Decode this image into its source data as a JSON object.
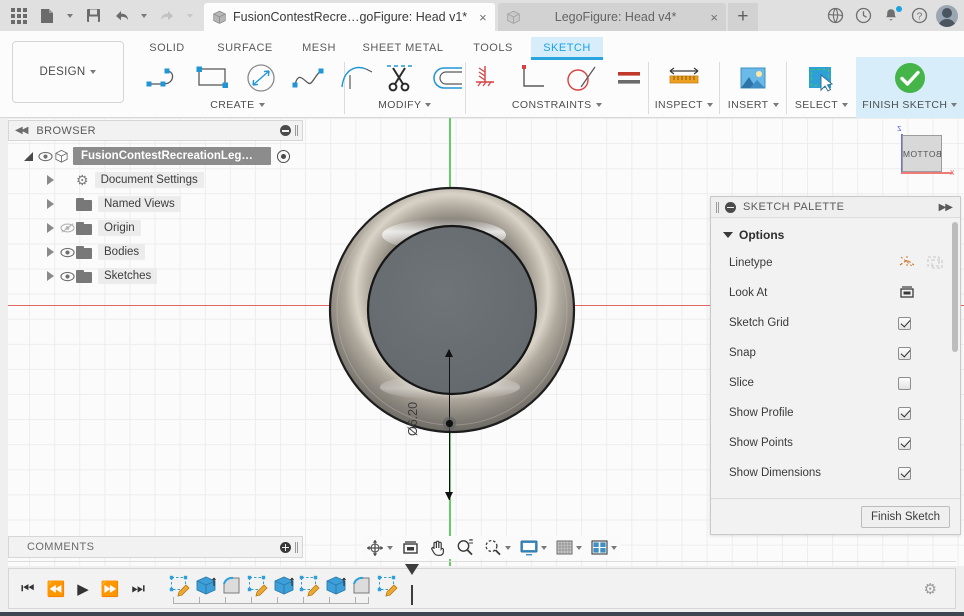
{
  "titlebar": {
    "app_menu_icon": "grid-apps-icon",
    "file_icon": "file-icon",
    "save_icon": "save-icon",
    "undo_icon": "undo-icon",
    "redo_icon": "redo-icon",
    "tabs": [
      {
        "label": "FusionContestRecre…goFigure: Head v1*",
        "icon": "cube-icon",
        "active": true,
        "close": "×"
      },
      {
        "label": "LegoFigure: Head v4*",
        "icon": "cube-icon",
        "active": false,
        "close": "×"
      }
    ],
    "new_tab_label": "+",
    "right_icons": [
      "globe-icon",
      "clock-icon",
      "bell-icon",
      "help-icon",
      "avatar"
    ]
  },
  "ribbon": {
    "design_label": "DESIGN",
    "workspace_tabs": [
      {
        "label": "SOLID",
        "active": false
      },
      {
        "label": "SURFACE",
        "active": false
      },
      {
        "label": "MESH",
        "active": false
      },
      {
        "label": "SHEET METAL",
        "active": false
      },
      {
        "label": "TOOLS",
        "active": false
      },
      {
        "label": "SKETCH",
        "active": true
      }
    ],
    "panels": [
      {
        "label": "CREATE",
        "dropdown": true,
        "tools": [
          "line-icon",
          "rectangle-icon",
          "circle-icon",
          "spline-icon",
          "arc-icon"
        ]
      },
      {
        "label": "MODIFY",
        "dropdown": true,
        "tools": [
          "trim-scissors-icon",
          "offset-icon"
        ]
      },
      {
        "label": "CONSTRAINTS",
        "dropdown": true,
        "tools": [
          "fix-constraint-icon",
          "perpendicular-icon",
          "tangent-icon",
          "equal-icon"
        ]
      },
      {
        "label": "INSPECT",
        "dropdown": true,
        "tools": [
          "measure-ruler-icon"
        ]
      },
      {
        "label": "INSERT",
        "dropdown": true,
        "tools": [
          "insert-image-icon"
        ]
      },
      {
        "label": "SELECT",
        "dropdown": true,
        "tools": [
          "select-cursor-icon"
        ]
      },
      {
        "label": "FINISH SKETCH",
        "dropdown": true,
        "tools": [
          "green-check-icon"
        ]
      }
    ]
  },
  "browser": {
    "header": "BROWSER",
    "collapse_icon": "collapse-left-icon",
    "minimize_icon": "minimize-dot-icon",
    "tree": [
      {
        "label": "FusionContestRecreationLeɡ…",
        "icon": "cube-icon",
        "eye": true,
        "root": true,
        "expanded": true,
        "target": true
      },
      {
        "label": "Document Settings",
        "icon": "gear-icon",
        "eye": false,
        "root": false,
        "expanded": false
      },
      {
        "label": "Named Views",
        "icon": "folder-icon",
        "eye": false,
        "root": false,
        "expanded": false
      },
      {
        "label": "Origin",
        "icon": "folder-icon",
        "eye": true,
        "eye_off": true,
        "root": false,
        "expanded": false
      },
      {
        "label": "Bodies",
        "icon": "folder-icon",
        "eye": true,
        "root": false,
        "expanded": false
      },
      {
        "label": "Sketches",
        "icon": "folder-icon",
        "eye": true,
        "root": false,
        "expanded": false
      }
    ]
  },
  "canvas": {
    "dimension_label": "Ø6.20",
    "viewcube_face": "BOTTOM",
    "viewcube_z": "z",
    "viewcube_x": "x",
    "axis_x_color": "#e06666",
    "axis_y_color": "#66cc66",
    "background": "#fbfbfb"
  },
  "palette": {
    "title": "SKETCH PALETTE",
    "minimize_icon": "minimize-dot-icon",
    "expand_icon": "expand-right-icon",
    "section": "Options",
    "rows": [
      {
        "label": "Linetype",
        "control": "icons",
        "icons": [
          "construction-line-icon",
          "centerline-icon"
        ]
      },
      {
        "label": "Look At",
        "control": "icon",
        "icons": [
          "look-at-icon"
        ]
      },
      {
        "label": "Sketch Grid",
        "control": "checkbox",
        "checked": true
      },
      {
        "label": "Snap",
        "control": "checkbox",
        "checked": true
      },
      {
        "label": "Slice",
        "control": "checkbox",
        "checked": false
      },
      {
        "label": "Show Profile",
        "control": "checkbox",
        "checked": true
      },
      {
        "label": "Show Points",
        "control": "checkbox",
        "checked": true
      },
      {
        "label": "Show Dimensions",
        "control": "checkbox",
        "checked": true
      }
    ],
    "finish_button": "Finish Sketch"
  },
  "comments": {
    "label": "COMMENTS",
    "add_icon": "add-comment-icon"
  },
  "navbar": {
    "items": [
      {
        "icon": "orbit-icon",
        "dropdown": true
      },
      {
        "icon": "look-at-icon",
        "dropdown": false
      },
      {
        "icon": "pan-hand-icon",
        "dropdown": false
      },
      {
        "icon": "zoom-icon",
        "dropdown": false
      },
      {
        "icon": "zoom-window-icon",
        "dropdown": true
      },
      {
        "icon": "display-settings-icon",
        "dropdown": true
      },
      {
        "icon": "grid-snaps-icon",
        "dropdown": true
      },
      {
        "icon": "viewports-icon",
        "dropdown": true
      }
    ]
  },
  "timeline": {
    "controls": [
      "skip-to-start-icon",
      "step-back-icon",
      "play-icon",
      "step-forward-icon",
      "skip-to-end-icon"
    ],
    "features": [
      "sketch-icon",
      "extrude-icon",
      "fillet-icon",
      "sketch-icon",
      "extrude-icon",
      "sketch-icon",
      "extrude-icon",
      "fillet-icon",
      "sketch-icon"
    ],
    "end_marker": "timeline-marker",
    "settings_icon": "gear-icon"
  }
}
